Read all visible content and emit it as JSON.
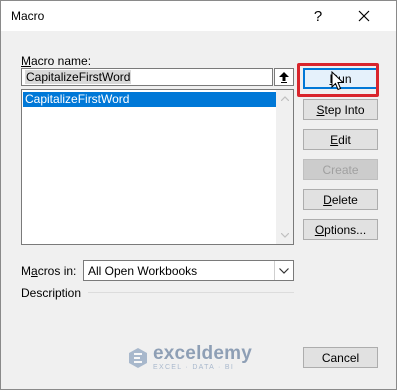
{
  "window": {
    "title": "Macro",
    "help_label": "?"
  },
  "macro_name": {
    "label_prefix": "",
    "label_hotkey": "M",
    "label_rest": "acro name:",
    "value": "CapitalizeFirstWord"
  },
  "macro_list": {
    "items": [
      "CapitalizeFirstWord"
    ]
  },
  "macros_in": {
    "label_prefix": "M",
    "label_hotkey": "a",
    "label_rest": "cros in:",
    "selected": "All Open Workbooks"
  },
  "description": {
    "label": "Description"
  },
  "buttons": {
    "run": {
      "hotkey": "R",
      "rest": "un"
    },
    "step_into": {
      "hotkey": "S",
      "rest": "tep Into"
    },
    "edit": {
      "hotkey": "E",
      "rest": "dit"
    },
    "create": {
      "label": "Create"
    },
    "delete": {
      "hotkey": "D",
      "rest": "elete"
    },
    "options": {
      "hotkey": "O",
      "rest": "ptions..."
    },
    "cancel": {
      "label": "Cancel"
    }
  },
  "watermark": {
    "brand": "exceldemy",
    "tagline": "EXCEL · DATA · BI"
  },
  "colors": {
    "selection": "#0078d7",
    "highlight": "#d9252c",
    "default_button": "#e5f1fb"
  },
  "icons": [
    "close-icon",
    "up-arrow-icon",
    "scroll-up-icon",
    "scroll-down-icon",
    "dropdown-chevron-icon",
    "cursor-icon",
    "exceldemy-logo-icon"
  ]
}
